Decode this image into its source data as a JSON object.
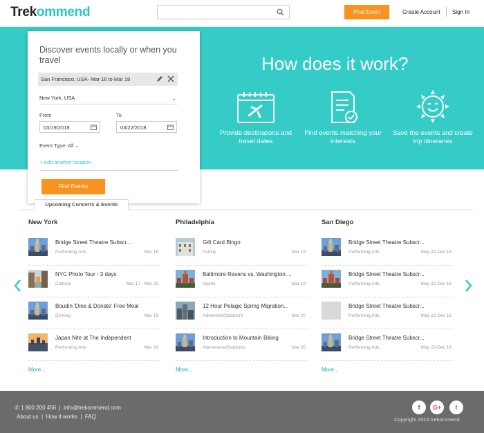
{
  "header": {
    "logo_part1": "Trek",
    "logo_part2": "ommend",
    "search_placeholder": "",
    "post_event": "Post Event",
    "create_account": "Create Account",
    "sign_in": "Sign In"
  },
  "hero": {
    "title": "How does it work?",
    "steps": [
      {
        "label": "Provide destinations and travel dates",
        "icon": "calendar-plane-icon"
      },
      {
        "label": "Find events matching your interests",
        "icon": "document-check-icon"
      },
      {
        "label": "Save the events and create trip itineraries",
        "icon": "smiling-sun-icon"
      }
    ]
  },
  "search_card": {
    "heading": "Discover events locally or when you travel",
    "active_trip": "San Francisco, USA- Mar 16 to Mar 18",
    "location_value": "New York, USA",
    "from_label": "From",
    "from_value": "03/19/2018",
    "to_label": "To",
    "to_value": "03/22/2018",
    "event_type": "Event Type: All",
    "add_location": "+ Add another location",
    "find_button": "Find Events"
  },
  "tab": {
    "label": "Upcoming Concerts & Events"
  },
  "columns": [
    {
      "city": "New York",
      "items": [
        {
          "title": "Bridge Street Theatre Subscr...",
          "category": "Performing Arts",
          "date": "Mar 18",
          "thumb": "skyline"
        },
        {
          "title": "NYC Photo Tour - 3 days",
          "category": "Cultural",
          "date": "Mar 17 - Mar 20",
          "thumb": "street"
        },
        {
          "title": "Boudin 'Dine & Donate' Free Meal",
          "category": "Dinning",
          "date": "Mar 19",
          "thumb": "skyline"
        },
        {
          "title": "Japan Nite at The Independent",
          "category": "Performing Arts",
          "date": "Mar 20",
          "thumb": "sunset"
        }
      ],
      "more": "More..."
    },
    {
      "city": "Philadelphia",
      "items": [
        {
          "title": "Gift Card Bingo",
          "category": "Family",
          "date": "Mar 19",
          "thumb": "building"
        },
        {
          "title": "Baltimore Ravens vs. Washington....",
          "category": "Sports",
          "date": "Mar 19",
          "thumb": "tower"
        },
        {
          "title": "12 Hour Pelagic Spring Migration...",
          "category": "Adventure/Outdoors",
          "date": "Mar 20",
          "thumb": "city"
        },
        {
          "title": "Introduction to Mountain Biking",
          "category": "Adeventure/Outdoors",
          "date": "Mar 20",
          "thumb": "skyline"
        }
      ],
      "more": "More..."
    },
    {
      "city": "San Diego",
      "items": [
        {
          "title": "Bridge Street Theatre Subscr...",
          "category": "Performing Arts",
          "date": "May 22-Dec 18",
          "thumb": "skyline"
        },
        {
          "title": "Bridge Street Theatre Subscr...",
          "category": "Performing Arts",
          "date": "May 22-Dec 18",
          "thumb": "tower"
        },
        {
          "title": "Bridge Street Theatre Subscr...",
          "category": "Performing Arts",
          "date": "May 22-Dec 18",
          "thumb": "blank"
        },
        {
          "title": "Bridge Street Theatre Subscr...",
          "category": "Performing Arts",
          "date": "May 22-Dec 18",
          "thumb": "skyline"
        }
      ],
      "more": "More..."
    }
  ],
  "footer": {
    "phone": "1 800 200 456",
    "email": "info@trekommend.com",
    "links": [
      "About us",
      "How it works",
      "FAQ"
    ],
    "copyright": "Copyright 2015 trekommend",
    "social": [
      {
        "name": "facebook",
        "glyph": "f",
        "color": "#3b5998"
      },
      {
        "name": "google-plus",
        "glyph": "G+",
        "color": "#dd4b39"
      },
      {
        "name": "twitter",
        "glyph": "t",
        "color": "#1da1f2"
      }
    ]
  },
  "colors": {
    "accent": "#35cbc7",
    "orange": "#f7931e",
    "footer": "#6b6b6b"
  }
}
